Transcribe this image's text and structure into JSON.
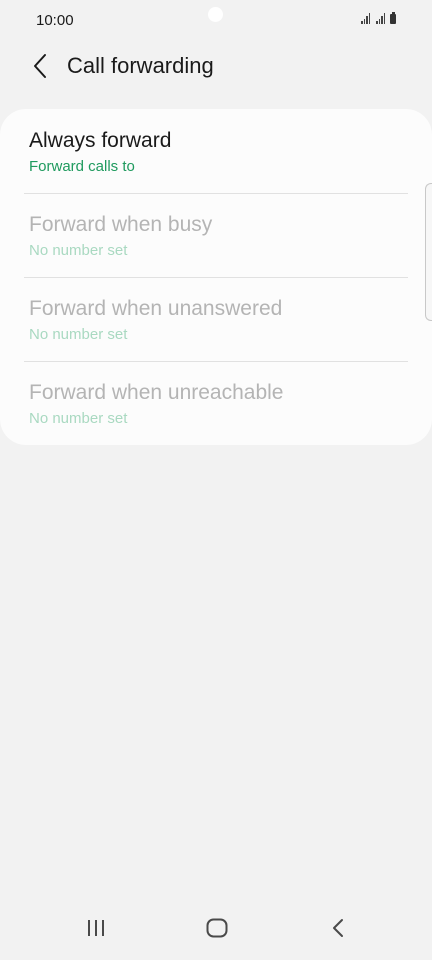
{
  "status_bar": {
    "time": "10:00"
  },
  "header": {
    "back_icon": "chevron-left-icon",
    "title": "Call forwarding"
  },
  "options": [
    {
      "title": "Always forward",
      "subtitle": "Forward calls to",
      "enabled": true
    },
    {
      "title": "Forward when busy",
      "subtitle": "No number set",
      "enabled": false
    },
    {
      "title": "Forward when unanswered",
      "subtitle": "No number set",
      "enabled": false
    },
    {
      "title": "Forward when unreachable",
      "subtitle": "No number set",
      "enabled": false
    }
  ],
  "nav_bar": {
    "recents_icon": "recents-icon",
    "home_icon": "home-icon",
    "back_icon": "back-icon"
  },
  "colors": {
    "background": "#f2f2f2",
    "card": "#fcfcfc",
    "accent_green": "#1f9a5e",
    "accent_green_disabled": "#a9d9c1",
    "disabled_text": "#b4b4b4"
  }
}
